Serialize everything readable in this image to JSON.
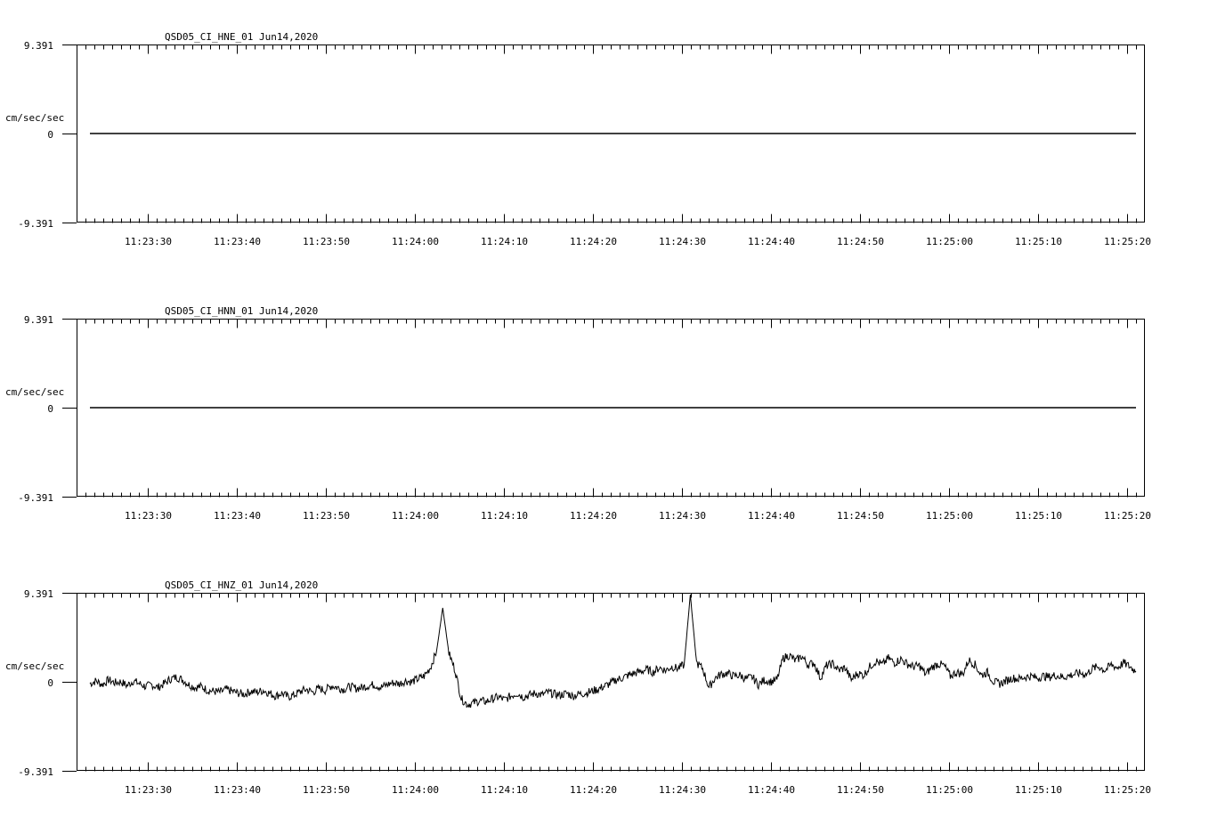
{
  "chart_data": [
    {
      "type": "line",
      "title": "QSD05_CI_HNE_01  Jun14,2020",
      "ylabel": "cm/sec/sec",
      "ylim": [
        -9.391,
        9.391
      ],
      "y_ticks": [
        "9.391",
        "0",
        "-9.391"
      ],
      "x_tick_labels": [
        "11:23:30",
        "11:23:40",
        "11:23:50",
        "11:24:00",
        "11:24:10",
        "11:24:20",
        "11:24:30",
        "11:24:40",
        "11:24:50",
        "11:25:00",
        "11:25:10",
        "11:25:20"
      ],
      "x_range": [
        "11:23:22.1",
        "11:25:20.8"
      ],
      "series": [
        {
          "values": [
            0,
            0,
            0,
            0,
            0,
            0,
            0,
            0,
            0,
            0,
            0,
            0,
            0,
            0,
            0,
            0,
            0,
            0,
            0,
            0,
            0,
            0,
            0,
            0,
            0
          ]
        }
      ]
    },
    {
      "type": "line",
      "title": "QSD05_CI_HNN_01  Jun14,2020",
      "ylabel": "cm/sec/sec",
      "ylim": [
        -9.391,
        9.391
      ],
      "y_ticks": [
        "9.391",
        "0",
        "-9.391"
      ],
      "x_tick_labels": [
        "11:23:30",
        "11:23:40",
        "11:23:50",
        "11:24:00",
        "11:24:10",
        "11:24:20",
        "11:24:30",
        "11:24:40",
        "11:24:50",
        "11:25:00",
        "11:25:10",
        "11:25:20"
      ],
      "x_range": [
        "11:23:22.1",
        "11:25:20.8"
      ],
      "series": [
        {
          "values": [
            0,
            0,
            0,
            0,
            0,
            0,
            0,
            0,
            0,
            0,
            0,
            0,
            0,
            0,
            0,
            0,
            0,
            0,
            0,
            0,
            0,
            0,
            0,
            0,
            0
          ]
        }
      ]
    },
    {
      "type": "line",
      "title": "QSD05_CI_HNZ_01  Jun14,2020",
      "ylabel": "cm/sec/sec",
      "ylim": [
        -9.391,
        9.391
      ],
      "y_ticks": [
        "9.391",
        "0",
        "-9.391"
      ],
      "x_tick_labels": [
        "11:23:30",
        "11:23:40",
        "11:23:50",
        "11:24:00",
        "11:24:10",
        "11:24:20",
        "11:24:30",
        "11:24:40",
        "11:24:50",
        "11:25:00",
        "11:25:10",
        "11:25:20"
      ],
      "x_range": [
        "11:23:22.1",
        "11:25:20.8"
      ],
      "series": [
        {
          "values": [
            -0.2,
            0.1,
            -0.3,
            0.2,
            -0.1,
            0.0,
            -0.4,
            0.1,
            -0.2,
            -0.5,
            -0.3,
            -0.6,
            -0.2,
            0.3,
            0.5,
            0.2,
            -0.3,
            -0.6,
            -0.5,
            -0.9,
            -1.0,
            -1.1,
            -0.8,
            -1.0,
            -1.2,
            -1.3,
            -1.0,
            -1.1,
            -0.9,
            -1.2,
            -1.5,
            -1.2,
            -1.6,
            -1.4,
            -1.0,
            -0.8,
            -1.1,
            -0.7,
            -0.9,
            -0.4,
            -0.6,
            -0.8,
            -0.5,
            -0.7,
            -0.6,
            -0.4,
            -0.3,
            -0.6,
            -0.3,
            -0.1,
            -0.2,
            0.1,
            0.0,
            0.3,
            0.6,
            1.5,
            3.2,
            7.8,
            3.0,
            1.2,
            -1.8,
            -2.4,
            -2.2,
            -2.0,
            -2.1,
            -1.8,
            -1.6,
            -1.9,
            -1.5,
            -1.2,
            -1.6,
            -1.4,
            -1.2,
            -1.4,
            -1.1,
            -1.3,
            -1.4,
            -1.2,
            -1.5,
            -1.3,
            -1.2,
            -1.0,
            -0.8,
            -0.5,
            -0.2,
            0.2,
            0.4,
            0.7,
            0.9,
            1.1,
            1.3,
            1.0,
            1.5,
            1.2,
            1.6,
            1.4,
            1.8,
            9.2,
            2.0,
            1.4,
            -0.6,
            0.4,
            0.8,
            0.9,
            0.6,
            0.7,
            0.3,
            0.5,
            -0.3,
            0.2,
            0.0,
            0.2,
            2.5,
            2.8,
            2.2,
            2.7,
            1.8,
            2.0,
            0.4,
            1.7,
            1.9,
            1.2,
            1.5,
            0.2,
            0.9,
            0.7,
            1.6,
            2.2,
            1.8,
            2.5,
            2.0,
            2.4,
            1.9,
            1.6,
            1.7,
            0.8,
            1.5,
            1.9,
            1.7,
            0.6,
            1.0,
            0.8,
            2.3,
            1.8,
            0.7,
            1.0,
            0.0,
            -0.2,
            0.1,
            0.4,
            0.3,
            0.5,
            0.6,
            0.4,
            0.6,
            0.5,
            0.7,
            0.5,
            0.6,
            0.8,
            0.9,
            0.8,
            1.4,
            1.6,
            1.2,
            1.8,
            1.5,
            2.0,
            1.6,
            1.1
          ]
        }
      ]
    }
  ]
}
